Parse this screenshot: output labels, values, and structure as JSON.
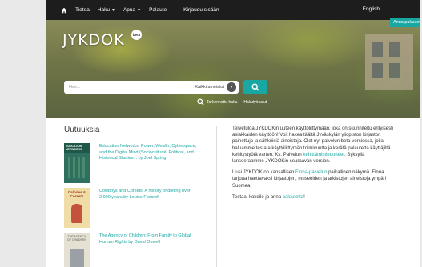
{
  "nav": {
    "items": [
      {
        "label": "Tietoa",
        "dropdown": false
      },
      {
        "label": "Haku",
        "dropdown": true
      },
      {
        "label": "Apua",
        "dropdown": true
      },
      {
        "label": "Palaute",
        "dropdown": false
      },
      {
        "label": "Kirjaudu sisään",
        "dropdown": false
      }
    ],
    "language": "English"
  },
  "beta_ribbon": "Anna palautetta",
  "logo": {
    "text": "JYKDOK",
    "badge": "beta"
  },
  "search": {
    "placeholder": "Hae...",
    "scope": "Kaikki aineistot",
    "advanced_link": "Tarkennettu haku",
    "tools_link": "Hakutyökalut"
  },
  "new_items": {
    "heading": "Uutuuksia",
    "books": [
      {
        "title": "Education Networks: Power, Wealth, Cyberspace, and the Digital Mind (Sociocultural, Political, and Historical Studies... by Joel Spring",
        "cover_color": "#2f6f5f",
        "cover_label": "EDUCATION NETWORKS"
      },
      {
        "title": "Cowboys and Corsets: A history of dieting over 2,000 years by Louise Foxcroft",
        "cover_color": "#d9b46b",
        "cover_label": "Calories & Corsets"
      },
      {
        "title": "The Agency of Children: From Family to Global Human Rights by David Oswell",
        "cover_color": "#e4e0d2",
        "cover_label": "THE AGENCY OF CHILDREN"
      }
    ]
  },
  "welcome": {
    "p1": "Tervetuloa JYKDOKin uuteen käyttöliittymään, joka on suunniteltu erityisesti asiakkaiden käyttöön! Voit hakea täältä Jyväskylän yliopiston kirjaston painettuja ja sähköisiä aineistoja. Olet nyt palvelun beta-versiossa, jolla haluamme testata käyttöliittymän toimivuutta ja kerätä palautetta käyttäjiltä kehitystyötä varten. Ks. Palvelun",
    "p1_link": "kehittämistiedotteet",
    "p1_end": ". Syksyllä lanseeraamme JYKDOKin seuraavan version.",
    "p2": "Uusi JYKDOK on kansallisen",
    "p2_link": "Finna-palvelun",
    "p2_end": " paikallinen näkymä. Finna tarjoaa haettavaksi kirjastojen, museoiden ja arkistojen aineistoja ympäri Suomea.",
    "p3": "Testaa, kokeile ja anna",
    "p3_link": "palautetta",
    "p3_end": "!"
  }
}
